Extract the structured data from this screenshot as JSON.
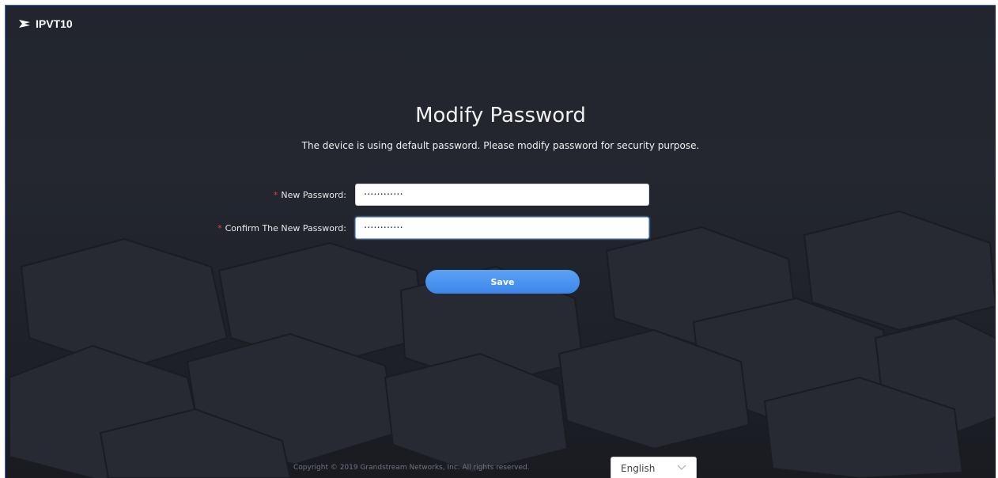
{
  "app": {
    "brand_name": "IPVT10",
    "logo_icon": "grandstream-logo-icon"
  },
  "page": {
    "title": "Modify Password",
    "subtitle": "The device is using default password. Please modify password for security purpose."
  },
  "form": {
    "required_marker": "*",
    "new_password": {
      "label": "New Password:",
      "value": "············"
    },
    "confirm_password": {
      "label": "Confirm The New Password:",
      "value": "············"
    },
    "save_label": "Save"
  },
  "footer": {
    "copyright": "Copyright © 2019 Grandstream Networks, Inc. All rights reserved.",
    "language": {
      "selected": "English",
      "icon": "chevron-down-icon"
    }
  },
  "colors": {
    "accent": "#4291ef",
    "required": "#e5413b",
    "background": "#22252d"
  }
}
